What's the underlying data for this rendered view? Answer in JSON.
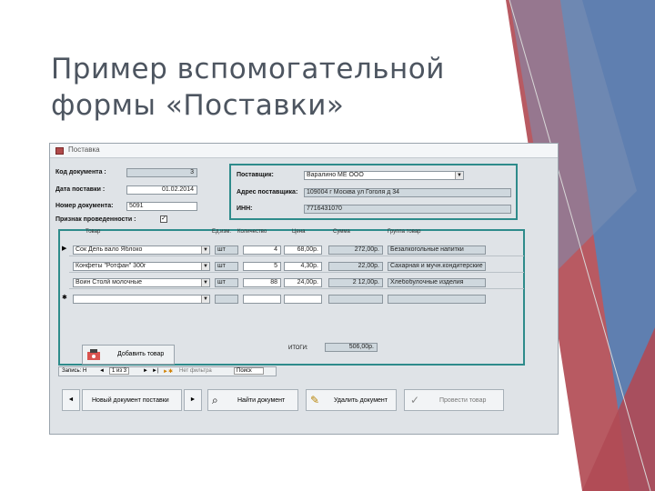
{
  "slide": {
    "title": "Пример вспомогательной формы «Поставки»"
  },
  "window": {
    "title": "Поставка"
  },
  "header": {
    "doc_code_label": "Код документа :",
    "doc_code_value": "3",
    "date_label": "Дата поставки :",
    "date_value": "01.02.2014",
    "doc_number_label": "Номер документа:",
    "doc_number_value": "5091",
    "accepted_label": "Признак проведенности :"
  },
  "supplier": {
    "supplier_label": "Поставщик:",
    "supplier_value": "Варалино МЕ ООО",
    "address_label": "Адрес поставщика:",
    "address_value": "109004 г Москва ул Гоголя д 34",
    "inn_label": "ИНН:",
    "inn_value": "7716431070"
  },
  "table": {
    "columns": [
      "Товар",
      "Ед.изм.",
      "Количество",
      "Цена",
      "Сумма",
      "Группа товар"
    ],
    "rows": [
      {
        "product": "Сок Дель вало Яблоко",
        "unit": "шт",
        "qty": "4",
        "price": "68,00р.",
        "sum": "272,00р.",
        "group": "Безалкогольные напитки"
      },
      {
        "product": "Конфеты \"Ротфан\" 300г",
        "unit": "шт",
        "qty": "5",
        "price": "4,30р.",
        "sum": "22,00р.",
        "group": "Сахарная и мучн.кондитерские"
      },
      {
        "product": "Воин Столй молочные",
        "unit": "шт",
        "qty": "88",
        "price": "24,00р.",
        "sum": "2 12,00р.",
        "group": "Хлебобулочные изделия"
      }
    ],
    "total_label": "ИТОГИ:",
    "total_value": "506,00р."
  },
  "add_button": {
    "label": "Добавить товар"
  },
  "record_nav": {
    "prefix": "Запись: Н",
    "position": "1 из 3",
    "filter": "Нет фильтра",
    "search": "Поиск"
  },
  "bottom": {
    "new_doc": "Новый документ поставки",
    "find_doc": "Найти документ",
    "delete_doc": "Удалить документ",
    "post_doc": "Провести товар"
  }
}
